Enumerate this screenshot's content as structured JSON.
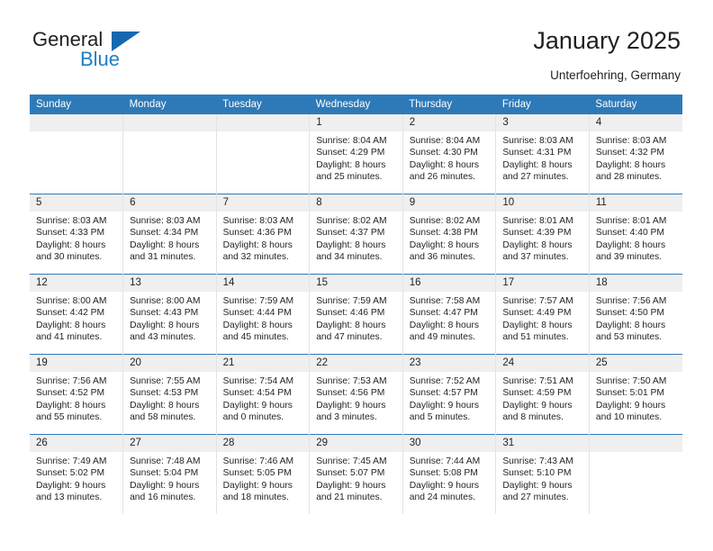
{
  "brand": {
    "name_top": "General",
    "name_bottom": "Blue",
    "accent_color": "#1f7fc4",
    "triangle_icon": "triangle-icon"
  },
  "header": {
    "title": "January 2025",
    "location": "Unterfoehring, Germany"
  },
  "calendar": {
    "header_bg": "#2e7ab8",
    "daynum_bg": "#efefef",
    "weekdays": [
      "Sunday",
      "Monday",
      "Tuesday",
      "Wednesday",
      "Thursday",
      "Friday",
      "Saturday"
    ],
    "labels": {
      "sunrise": "Sunrise:",
      "sunset": "Sunset:",
      "daylight": "Daylight:"
    },
    "weeks": [
      [
        {
          "day": ""
        },
        {
          "day": ""
        },
        {
          "day": ""
        },
        {
          "day": "1",
          "sunrise": "Sunrise: 8:04 AM",
          "sunset": "Sunset: 4:29 PM",
          "daylight_1": "Daylight: 8 hours",
          "daylight_2": "and 25 minutes."
        },
        {
          "day": "2",
          "sunrise": "Sunrise: 8:04 AM",
          "sunset": "Sunset: 4:30 PM",
          "daylight_1": "Daylight: 8 hours",
          "daylight_2": "and 26 minutes."
        },
        {
          "day": "3",
          "sunrise": "Sunrise: 8:03 AM",
          "sunset": "Sunset: 4:31 PM",
          "daylight_1": "Daylight: 8 hours",
          "daylight_2": "and 27 minutes."
        },
        {
          "day": "4",
          "sunrise": "Sunrise: 8:03 AM",
          "sunset": "Sunset: 4:32 PM",
          "daylight_1": "Daylight: 8 hours",
          "daylight_2": "and 28 minutes."
        }
      ],
      [
        {
          "day": "5",
          "sunrise": "Sunrise: 8:03 AM",
          "sunset": "Sunset: 4:33 PM",
          "daylight_1": "Daylight: 8 hours",
          "daylight_2": "and 30 minutes."
        },
        {
          "day": "6",
          "sunrise": "Sunrise: 8:03 AM",
          "sunset": "Sunset: 4:34 PM",
          "daylight_1": "Daylight: 8 hours",
          "daylight_2": "and 31 minutes."
        },
        {
          "day": "7",
          "sunrise": "Sunrise: 8:03 AM",
          "sunset": "Sunset: 4:36 PM",
          "daylight_1": "Daylight: 8 hours",
          "daylight_2": "and 32 minutes."
        },
        {
          "day": "8",
          "sunrise": "Sunrise: 8:02 AM",
          "sunset": "Sunset: 4:37 PM",
          "daylight_1": "Daylight: 8 hours",
          "daylight_2": "and 34 minutes."
        },
        {
          "day": "9",
          "sunrise": "Sunrise: 8:02 AM",
          "sunset": "Sunset: 4:38 PM",
          "daylight_1": "Daylight: 8 hours",
          "daylight_2": "and 36 minutes."
        },
        {
          "day": "10",
          "sunrise": "Sunrise: 8:01 AM",
          "sunset": "Sunset: 4:39 PM",
          "daylight_1": "Daylight: 8 hours",
          "daylight_2": "and 37 minutes."
        },
        {
          "day": "11",
          "sunrise": "Sunrise: 8:01 AM",
          "sunset": "Sunset: 4:40 PM",
          "daylight_1": "Daylight: 8 hours",
          "daylight_2": "and 39 minutes."
        }
      ],
      [
        {
          "day": "12",
          "sunrise": "Sunrise: 8:00 AM",
          "sunset": "Sunset: 4:42 PM",
          "daylight_1": "Daylight: 8 hours",
          "daylight_2": "and 41 minutes."
        },
        {
          "day": "13",
          "sunrise": "Sunrise: 8:00 AM",
          "sunset": "Sunset: 4:43 PM",
          "daylight_1": "Daylight: 8 hours",
          "daylight_2": "and 43 minutes."
        },
        {
          "day": "14",
          "sunrise": "Sunrise: 7:59 AM",
          "sunset": "Sunset: 4:44 PM",
          "daylight_1": "Daylight: 8 hours",
          "daylight_2": "and 45 minutes."
        },
        {
          "day": "15",
          "sunrise": "Sunrise: 7:59 AM",
          "sunset": "Sunset: 4:46 PM",
          "daylight_1": "Daylight: 8 hours",
          "daylight_2": "and 47 minutes."
        },
        {
          "day": "16",
          "sunrise": "Sunrise: 7:58 AM",
          "sunset": "Sunset: 4:47 PM",
          "daylight_1": "Daylight: 8 hours",
          "daylight_2": "and 49 minutes."
        },
        {
          "day": "17",
          "sunrise": "Sunrise: 7:57 AM",
          "sunset": "Sunset: 4:49 PM",
          "daylight_1": "Daylight: 8 hours",
          "daylight_2": "and 51 minutes."
        },
        {
          "day": "18",
          "sunrise": "Sunrise: 7:56 AM",
          "sunset": "Sunset: 4:50 PM",
          "daylight_1": "Daylight: 8 hours",
          "daylight_2": "and 53 minutes."
        }
      ],
      [
        {
          "day": "19",
          "sunrise": "Sunrise: 7:56 AM",
          "sunset": "Sunset: 4:52 PM",
          "daylight_1": "Daylight: 8 hours",
          "daylight_2": "and 55 minutes."
        },
        {
          "day": "20",
          "sunrise": "Sunrise: 7:55 AM",
          "sunset": "Sunset: 4:53 PM",
          "daylight_1": "Daylight: 8 hours",
          "daylight_2": "and 58 minutes."
        },
        {
          "day": "21",
          "sunrise": "Sunrise: 7:54 AM",
          "sunset": "Sunset: 4:54 PM",
          "daylight_1": "Daylight: 9 hours",
          "daylight_2": "and 0 minutes."
        },
        {
          "day": "22",
          "sunrise": "Sunrise: 7:53 AM",
          "sunset": "Sunset: 4:56 PM",
          "daylight_1": "Daylight: 9 hours",
          "daylight_2": "and 3 minutes."
        },
        {
          "day": "23",
          "sunrise": "Sunrise: 7:52 AM",
          "sunset": "Sunset: 4:57 PM",
          "daylight_1": "Daylight: 9 hours",
          "daylight_2": "and 5 minutes."
        },
        {
          "day": "24",
          "sunrise": "Sunrise: 7:51 AM",
          "sunset": "Sunset: 4:59 PM",
          "daylight_1": "Daylight: 9 hours",
          "daylight_2": "and 8 minutes."
        },
        {
          "day": "25",
          "sunrise": "Sunrise: 7:50 AM",
          "sunset": "Sunset: 5:01 PM",
          "daylight_1": "Daylight: 9 hours",
          "daylight_2": "and 10 minutes."
        }
      ],
      [
        {
          "day": "26",
          "sunrise": "Sunrise: 7:49 AM",
          "sunset": "Sunset: 5:02 PM",
          "daylight_1": "Daylight: 9 hours",
          "daylight_2": "and 13 minutes."
        },
        {
          "day": "27",
          "sunrise": "Sunrise: 7:48 AM",
          "sunset": "Sunset: 5:04 PM",
          "daylight_1": "Daylight: 9 hours",
          "daylight_2": "and 16 minutes."
        },
        {
          "day": "28",
          "sunrise": "Sunrise: 7:46 AM",
          "sunset": "Sunset: 5:05 PM",
          "daylight_1": "Daylight: 9 hours",
          "daylight_2": "and 18 minutes."
        },
        {
          "day": "29",
          "sunrise": "Sunrise: 7:45 AM",
          "sunset": "Sunset: 5:07 PM",
          "daylight_1": "Daylight: 9 hours",
          "daylight_2": "and 21 minutes."
        },
        {
          "day": "30",
          "sunrise": "Sunrise: 7:44 AM",
          "sunset": "Sunset: 5:08 PM",
          "daylight_1": "Daylight: 9 hours",
          "daylight_2": "and 24 minutes."
        },
        {
          "day": "31",
          "sunrise": "Sunrise: 7:43 AM",
          "sunset": "Sunset: 5:10 PM",
          "daylight_1": "Daylight: 9 hours",
          "daylight_2": "and 27 minutes."
        },
        {
          "day": ""
        }
      ]
    ]
  }
}
